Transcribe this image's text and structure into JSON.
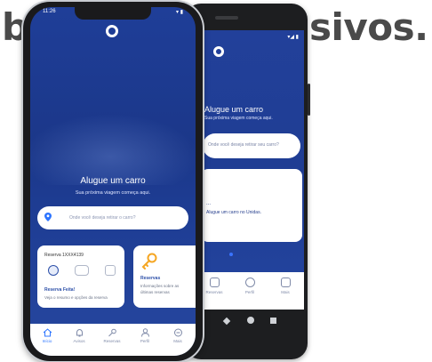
{
  "headline": {
    "left": "b",
    "right": "sivos."
  },
  "android": {
    "status": "▾◢ ▮",
    "title": "Alugue um carro",
    "subtitle": "Sua próxima viagem começa aqui.",
    "search_placeholder": "Onde você deseja retirar seu carro?",
    "card_title": "...",
    "card_text": "Alugue um carro no Unidas.",
    "tabs": [
      {
        "label": "Reservas"
      },
      {
        "label": "Perfil"
      },
      {
        "label": "Mais"
      }
    ]
  },
  "iphone": {
    "time": "11:26",
    "status": "▾ ▮",
    "title": "Alugue um carro",
    "subtitle": "Sua próxima viagem começa aqui.",
    "search_placeholder": "Onde você deseja retirar o carro?",
    "reservation_card": {
      "title": "Reserva 1XXX4139",
      "link": "Reserva Feita!",
      "description": "Veja o resumo e opções da reserva"
    },
    "reservations_card": {
      "title": "Reservas",
      "description_line1": "Informações sobre as",
      "description_line2": "últimas reservas"
    },
    "tabs": [
      {
        "label": "Início",
        "icon": "home-icon",
        "active": true
      },
      {
        "label": "Avisos",
        "icon": "bell-icon"
      },
      {
        "label": "Reservas",
        "icon": "key-icon"
      },
      {
        "label": "Perfil",
        "icon": "user-icon"
      },
      {
        "label": "Mais",
        "icon": "more-icon"
      }
    ]
  },
  "colors": {
    "brand_blue": "#1f3e98",
    "accent": "#2c74ff",
    "headline": "#4a4a4a",
    "key_orange": "#f5a623"
  }
}
